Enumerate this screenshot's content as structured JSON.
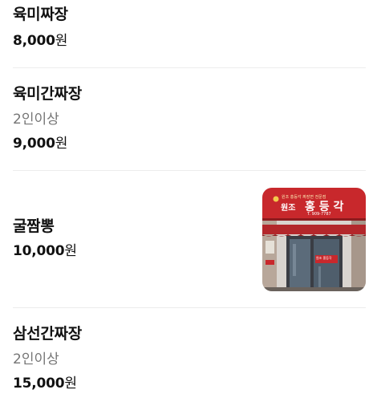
{
  "menu": {
    "items": [
      {
        "name": "육미짜장",
        "desc": "",
        "price": "8,000",
        "unit": "원"
      },
      {
        "name": "육미간짜장",
        "desc": "2인이상",
        "price": "9,000",
        "unit": "원"
      },
      {
        "name": "굴짬뽕",
        "desc": "",
        "price": "10,000",
        "unit": "원",
        "has_photo": true
      },
      {
        "name": "삼선간짜장",
        "desc": "2인이상",
        "price": "15,000",
        "unit": "원"
      }
    ]
  },
  "photo": {
    "sign_small": "원조 홍등각 짜장면 전문점",
    "sign_main_left": "원조",
    "sign_main_right": "홍 등 각",
    "sign_phone": "T. 909-7787",
    "door_sign": "원조 홍등각",
    "colors": {
      "sign_red": "#c8282c",
      "awning": "#b3272b",
      "door_frame": "#3a3d44"
    }
  }
}
